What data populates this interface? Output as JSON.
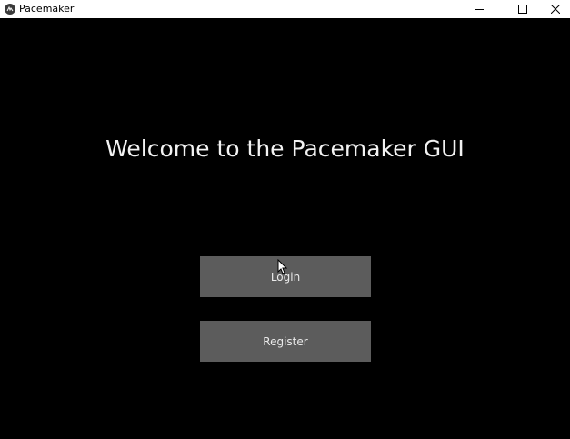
{
  "window": {
    "title": "Pacemaker",
    "controls": {
      "minimize_icon": "minimize-icon",
      "maximize_icon": "maximize-icon",
      "close_icon": "close-icon"
    }
  },
  "main": {
    "heading": "Welcome to the Pacemaker GUI",
    "login_label": "Login",
    "register_label": "Register"
  },
  "colors": {
    "background": "#000000",
    "button": "#5c5c5c",
    "text": "#f2f2f2"
  }
}
